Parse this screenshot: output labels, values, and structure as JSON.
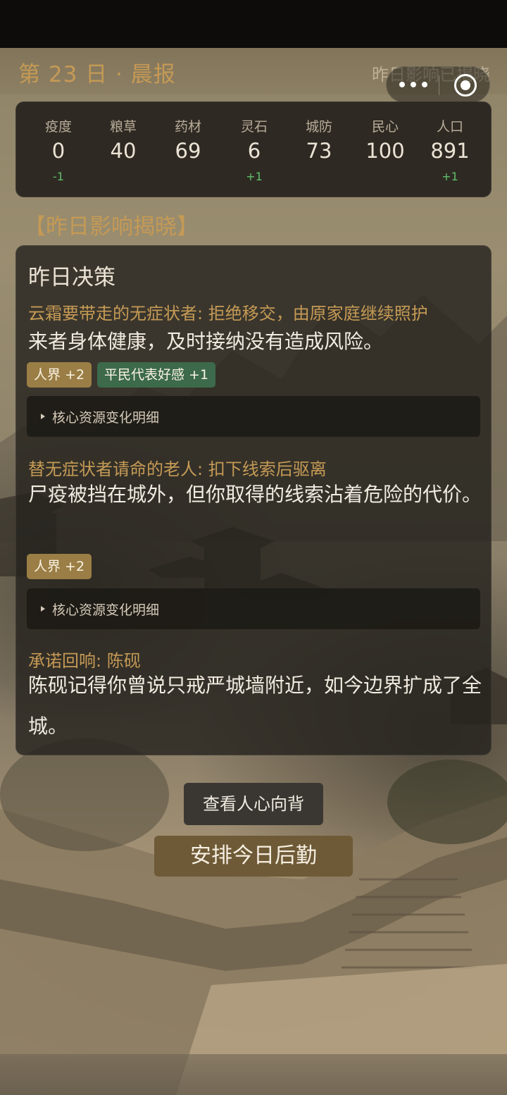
{
  "header": {
    "title": "第 23 日 · 晨报",
    "status": "昨日影响已揭晓"
  },
  "capsule": {
    "more_icon": "more-dots-icon",
    "close_icon": "target-close-icon"
  },
  "stats": [
    {
      "label": "疫度",
      "value": "0",
      "delta": "-1"
    },
    {
      "label": "粮草",
      "value": "40",
      "delta": ""
    },
    {
      "label": "药材",
      "value": "69",
      "delta": ""
    },
    {
      "label": "灵石",
      "value": "6",
      "delta": "+1"
    },
    {
      "label": "城防",
      "value": "73",
      "delta": ""
    },
    {
      "label": "民心",
      "value": "100",
      "delta": ""
    },
    {
      "label": "人口",
      "value": "891",
      "delta": "+1"
    }
  ],
  "section_title": "【昨日影响揭晓】",
  "card": {
    "title": "昨日决策",
    "decisions": [
      {
        "choice": "云霜要带走的无症状者: 拒绝移交，由原家庭继续照护",
        "result": "来者身体健康，及时接纳没有造成风险。",
        "tags": [
          "人界 +2",
          "平民代表好感 +1"
        ],
        "detail_label": "核心资源变化明细"
      },
      {
        "choice": "替无症状者请命的老人: 扣下线索后驱离",
        "result": "尸疫被挡在城外，但你取得的线索沾着危险的代价。",
        "tags": [
          "人界 +2"
        ],
        "detail_label": "核心资源变化明细"
      }
    ],
    "promise": {
      "title": "承诺回响: 陈砚",
      "text": "陈砚记得你曾说只戒严城墙附近，如今边界扩成了全城。"
    }
  },
  "buttons": {
    "view_sentiment": "查看人心向背",
    "arrange_logistics": "安排今日后勤"
  },
  "colors": {
    "accent": "#c59a55",
    "positive": "#5fbf6a",
    "tag_gold": "#9a7e45",
    "tag_green": "#3c6a4a"
  }
}
